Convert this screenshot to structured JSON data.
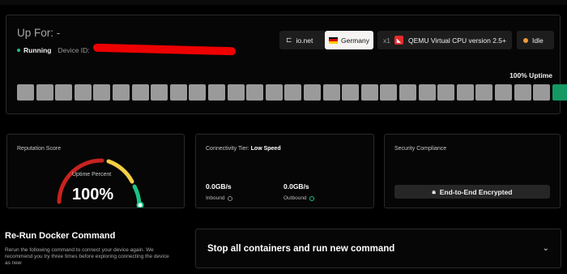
{
  "device": {
    "up_for": "Up For: -",
    "status": "Running",
    "device_id_label": "Device ID:",
    "uptime_label": "100% Uptime",
    "uptime_percent": 100,
    "chips": {
      "network": "io.net",
      "country": "Germany",
      "cpu_multiplier": "x1",
      "cpu": "QEMU Virtual CPU version 2.5+",
      "idle": "Idle"
    },
    "uptime_bars": [
      "gray",
      "gray",
      "gray",
      "gray",
      "gray",
      "gray",
      "gray",
      "gray",
      "gray",
      "gray",
      "gray",
      "gray",
      "gray",
      "gray",
      "gray",
      "gray",
      "gray",
      "gray",
      "gray",
      "gray",
      "gray",
      "gray",
      "gray",
      "gray",
      "gray",
      "gray",
      "gray",
      "gray",
      "green"
    ]
  },
  "reputation": {
    "title": "Reputation Score",
    "caption": "Uptime Percent",
    "value_text": "100%",
    "value": 100
  },
  "connectivity": {
    "title": "Connectivity Tier:",
    "tier": "Low Speed",
    "inbound_value": "0.0GB/s",
    "inbound_label": "Inbound",
    "outbound_value": "0.0GB/s",
    "outbound_label": "Outbound"
  },
  "security": {
    "title": "Security Compliance",
    "badge": "End-to-End Encrypted"
  },
  "rerun": {
    "title": "Re-Run Docker Command",
    "description": "Rerun the following command to connect your device again. We recommend you try three times before exploring connecting the device as new",
    "selected_option": "Stop all containers and run new command"
  },
  "colors": {
    "bar_gray": "#9a9a9a",
    "bar_green": "#149964",
    "gauge_red": "#c7231f",
    "gauge_yellow": "#f3cf45",
    "gauge_green": "#18c486",
    "running_dot": "#18c486",
    "idle_dot": "#ee9a3a"
  }
}
